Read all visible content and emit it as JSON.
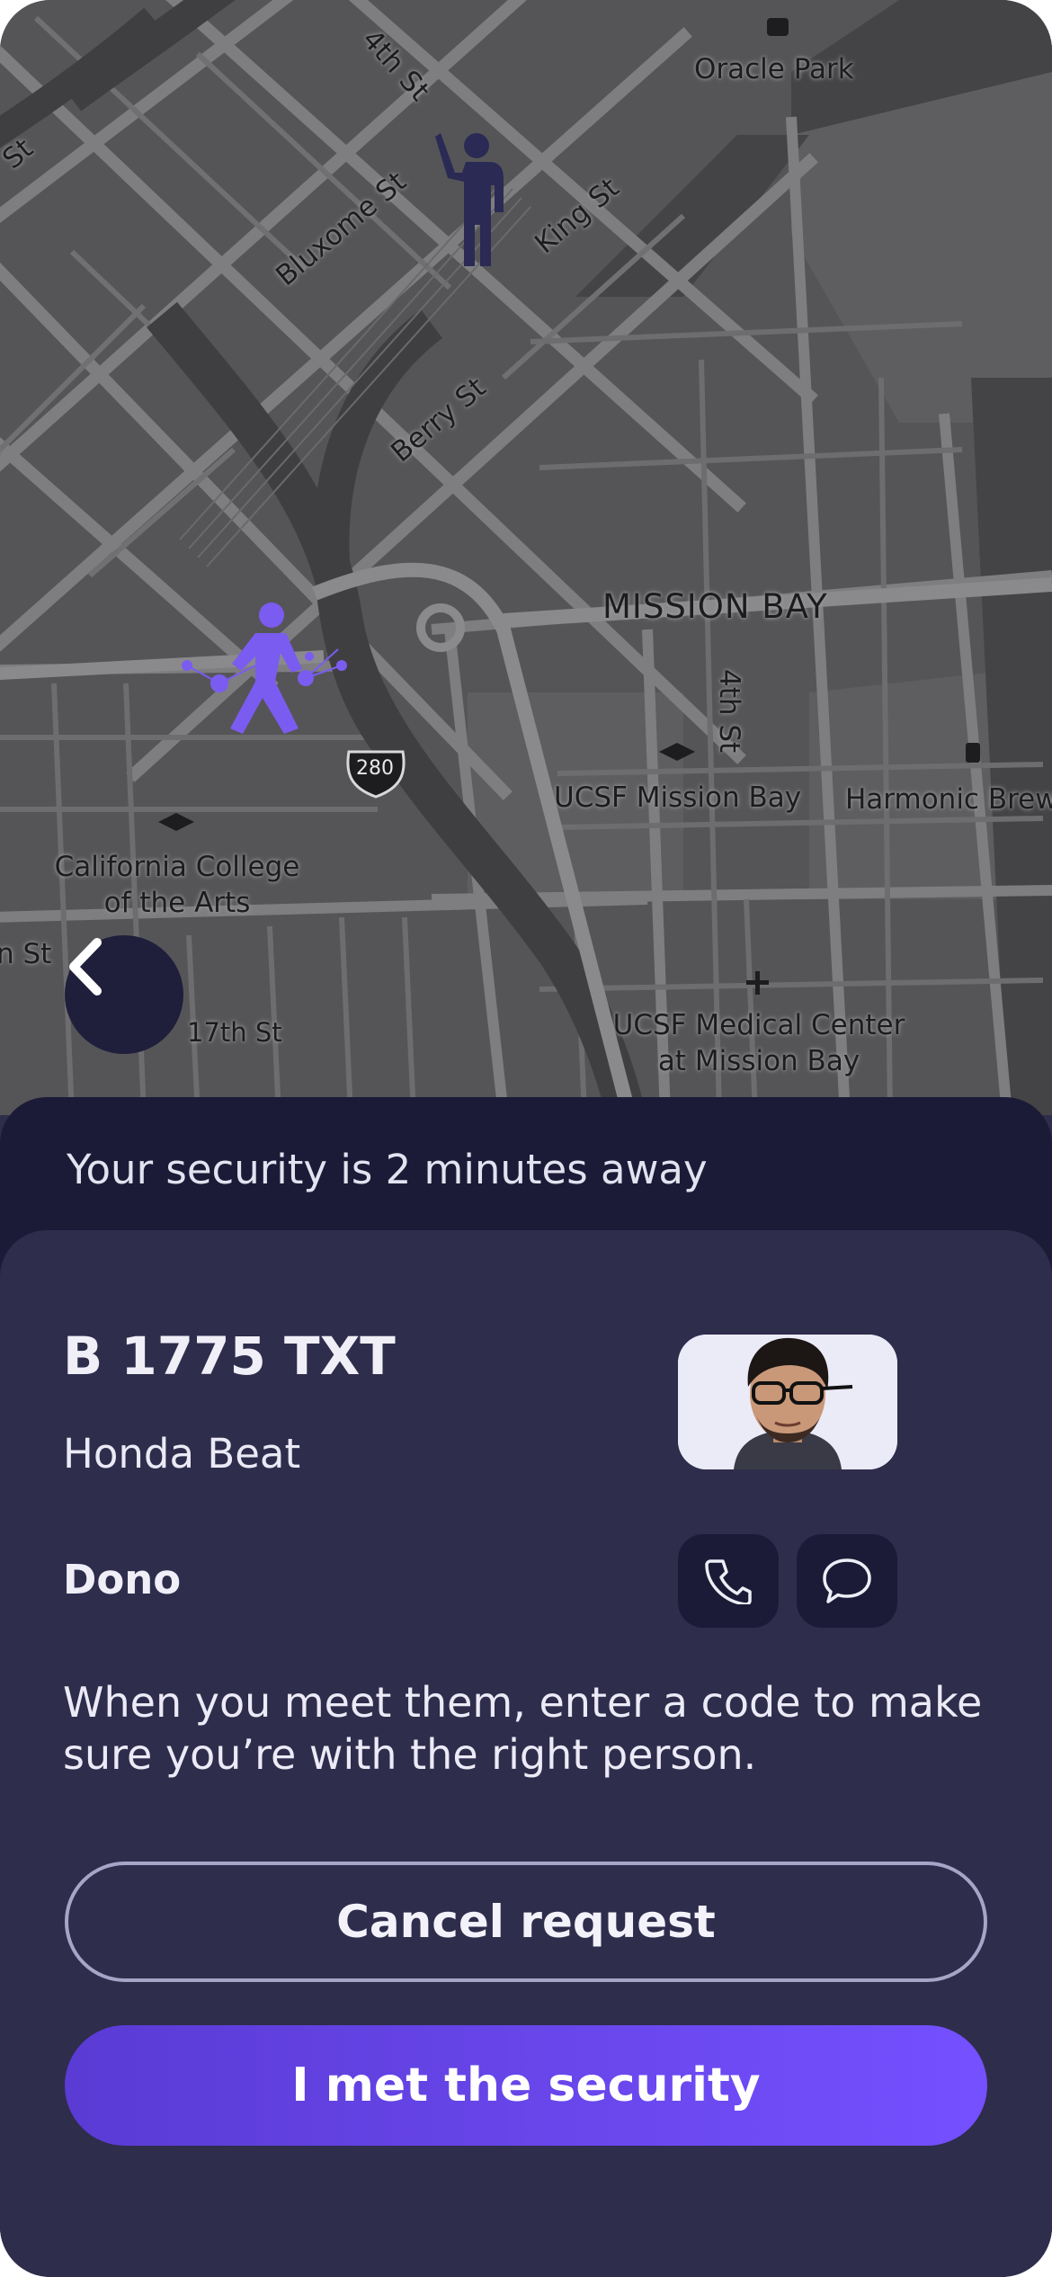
{
  "map": {
    "labels": {
      "fourth_st_top": "4th St",
      "oracle_park": "Oracle Park",
      "st_left": "St",
      "bluxome_st": "Bluxome St",
      "king_st": "King St",
      "berry_st": "Berry St",
      "mission_bay": "MISSION BAY",
      "fourth_st_mid": "4th St",
      "interstate": "280",
      "ucsf_mission_bay": "UCSF Mission Bay",
      "harmonic_brew": "Harmonic Brew",
      "california_college": "California College\nof the Arts",
      "n_st": "n St",
      "seventeenth_st": "17th St",
      "ucsf_medical": "UCSF Medical Center\nat Mission Bay"
    },
    "colors": {
      "security_marker": "#7b5cf0",
      "user_marker": "#2a2a55"
    },
    "icons": {
      "security_marker": "running-person-icon",
      "user_marker": "waving-person-icon",
      "back": "chevron-left-icon"
    }
  },
  "status": {
    "eta_text": "Your security is 2 minutes away"
  },
  "driver": {
    "plate": "B 1775 TXT",
    "vehicle": "Honda Beat",
    "name": "Dono",
    "call_icon": "phone-icon",
    "message_icon": "chat-bubble-icon"
  },
  "hint": "When you meet them, enter a code to make sure you’re with the right person.",
  "actions": {
    "cancel_label": "Cancel request",
    "met_label": "I met the security"
  },
  "theme": {
    "accent": "#6b46f5",
    "sheet_dark": "#1c1b37",
    "card": "#2e2d4c"
  }
}
